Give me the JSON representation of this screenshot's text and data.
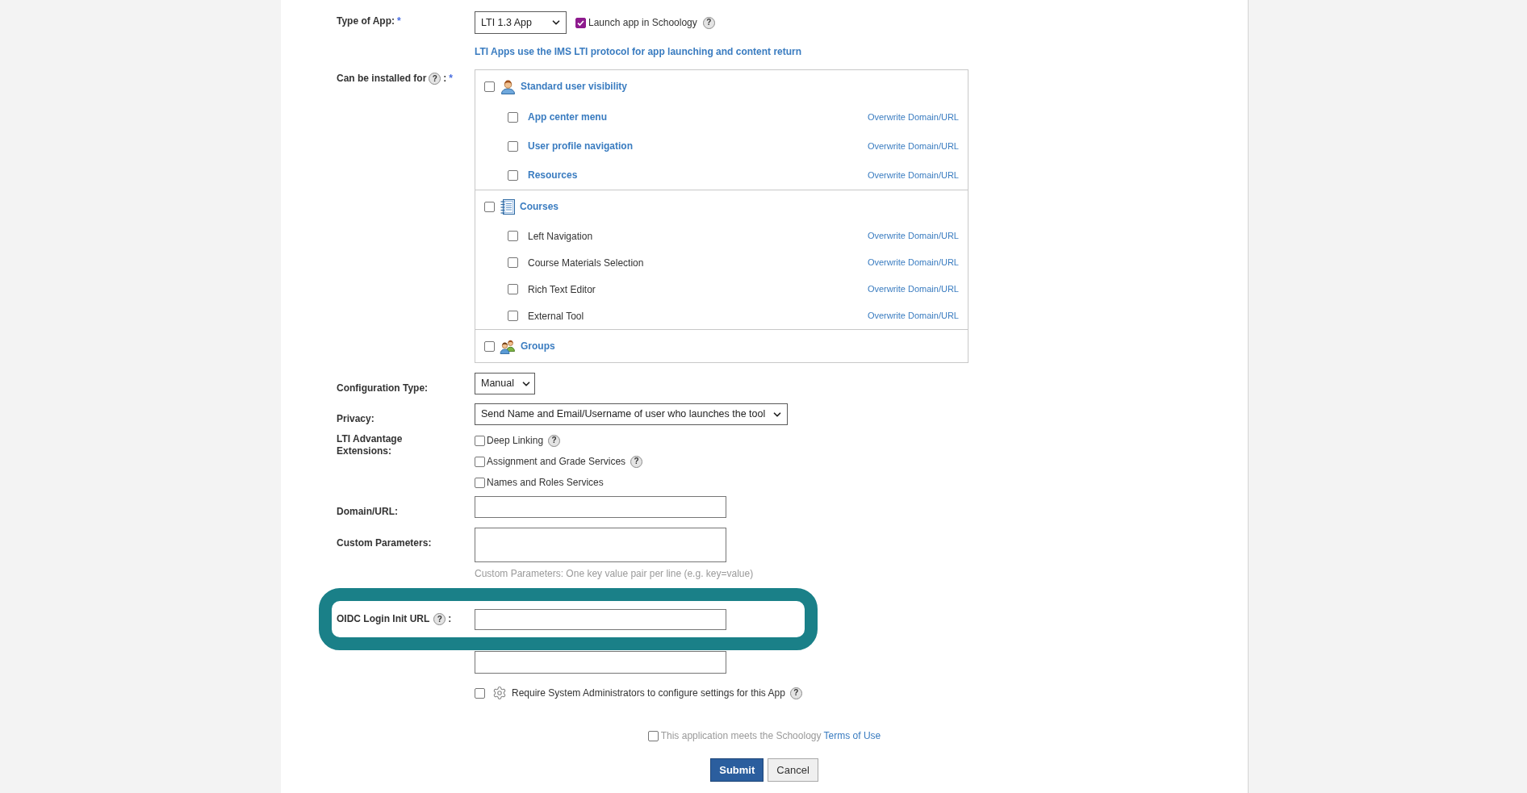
{
  "type_of_app": {
    "label": "Type of App:",
    "required_mark": "*",
    "select": {
      "value": "LTI 1.3 App"
    },
    "launch": {
      "label": "Launch app in Schoology",
      "checked": true,
      "help": "?"
    },
    "note": "LTI Apps use the IMS LTI protocol for app launching and content return"
  },
  "installed_for": {
    "label": "Can be installed for",
    "help": "?",
    "suffix": ":",
    "required_mark": "*",
    "groups": [
      {
        "title": "Standard user visibility",
        "checked": false,
        "items": [
          {
            "label": "App center menu",
            "kind": "link",
            "checked": false,
            "action": "Overwrite Domain/URL"
          },
          {
            "label": "User profile navigation",
            "kind": "link",
            "checked": false,
            "action": "Overwrite Domain/URL"
          },
          {
            "label": "Resources",
            "kind": "link",
            "checked": false,
            "action": "Overwrite Domain/URL"
          }
        ]
      },
      {
        "title": "Courses",
        "checked": false,
        "items": [
          {
            "label": "Left Navigation",
            "kind": "text",
            "checked": false,
            "action": "Overwrite Domain/URL"
          },
          {
            "label": "Course Materials Selection",
            "kind": "text",
            "checked": false,
            "action": "Overwrite Domain/URL"
          },
          {
            "label": "Rich Text Editor",
            "kind": "text",
            "checked": false,
            "action": "Overwrite Domain/URL"
          },
          {
            "label": "External Tool",
            "kind": "text",
            "checked": false,
            "action": "Overwrite Domain/URL"
          }
        ]
      },
      {
        "title": "Groups",
        "checked": false
      }
    ]
  },
  "configuration_type": {
    "label": "Configuration Type:",
    "value": "Manual"
  },
  "privacy": {
    "label": "Privacy:",
    "value": "Send Name and Email/Username of user who launches the tool"
  },
  "extensions": {
    "label": "LTI Advantage Extensions:",
    "options": [
      {
        "label": "Deep Linking",
        "checked": false,
        "help": "?"
      },
      {
        "label": "Assignment and Grade Services",
        "checked": false,
        "help": "?"
      },
      {
        "label": "Names and Roles Services",
        "checked": false
      }
    ]
  },
  "domain_url": {
    "label": "Domain/URL:"
  },
  "custom_parameters": {
    "label": "Custom Parameters:",
    "hint": "Custom Parameters: One key value pair per line (e.g. key=value)"
  },
  "oidc_login": {
    "label": "OIDC Login Init URL",
    "help": "?",
    "suffix": ":",
    "highlighted": true
  },
  "require_admins": {
    "label": "Require System Administrators to configure settings for this App",
    "checked": false,
    "help": "?"
  },
  "terms": {
    "text": "This application meets the Schoology",
    "link": "Terms of Use",
    "checked": false
  },
  "buttons": [
    {
      "label": "Submit",
      "kind": "primary"
    },
    {
      "label": "Cancel",
      "kind": "secondary"
    }
  ]
}
